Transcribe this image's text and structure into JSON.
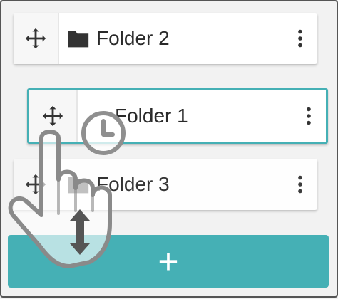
{
  "rows": [
    {
      "label": "Folder 2"
    },
    {
      "label": "Folder 1"
    },
    {
      "label": "Folder 3"
    }
  ],
  "add_button": {
    "label": "+"
  },
  "colors": {
    "accent": "#45b0b5",
    "icon": "#333333",
    "background": "#f2f2f2"
  },
  "icons": {
    "drag": "move-arrows-icon",
    "folder": "folder-icon",
    "menu": "more-vertical-icon",
    "hold": "clock-icon",
    "gesture": "hand-pointer-icon",
    "vertical_drag": "up-down-arrow-icon"
  }
}
